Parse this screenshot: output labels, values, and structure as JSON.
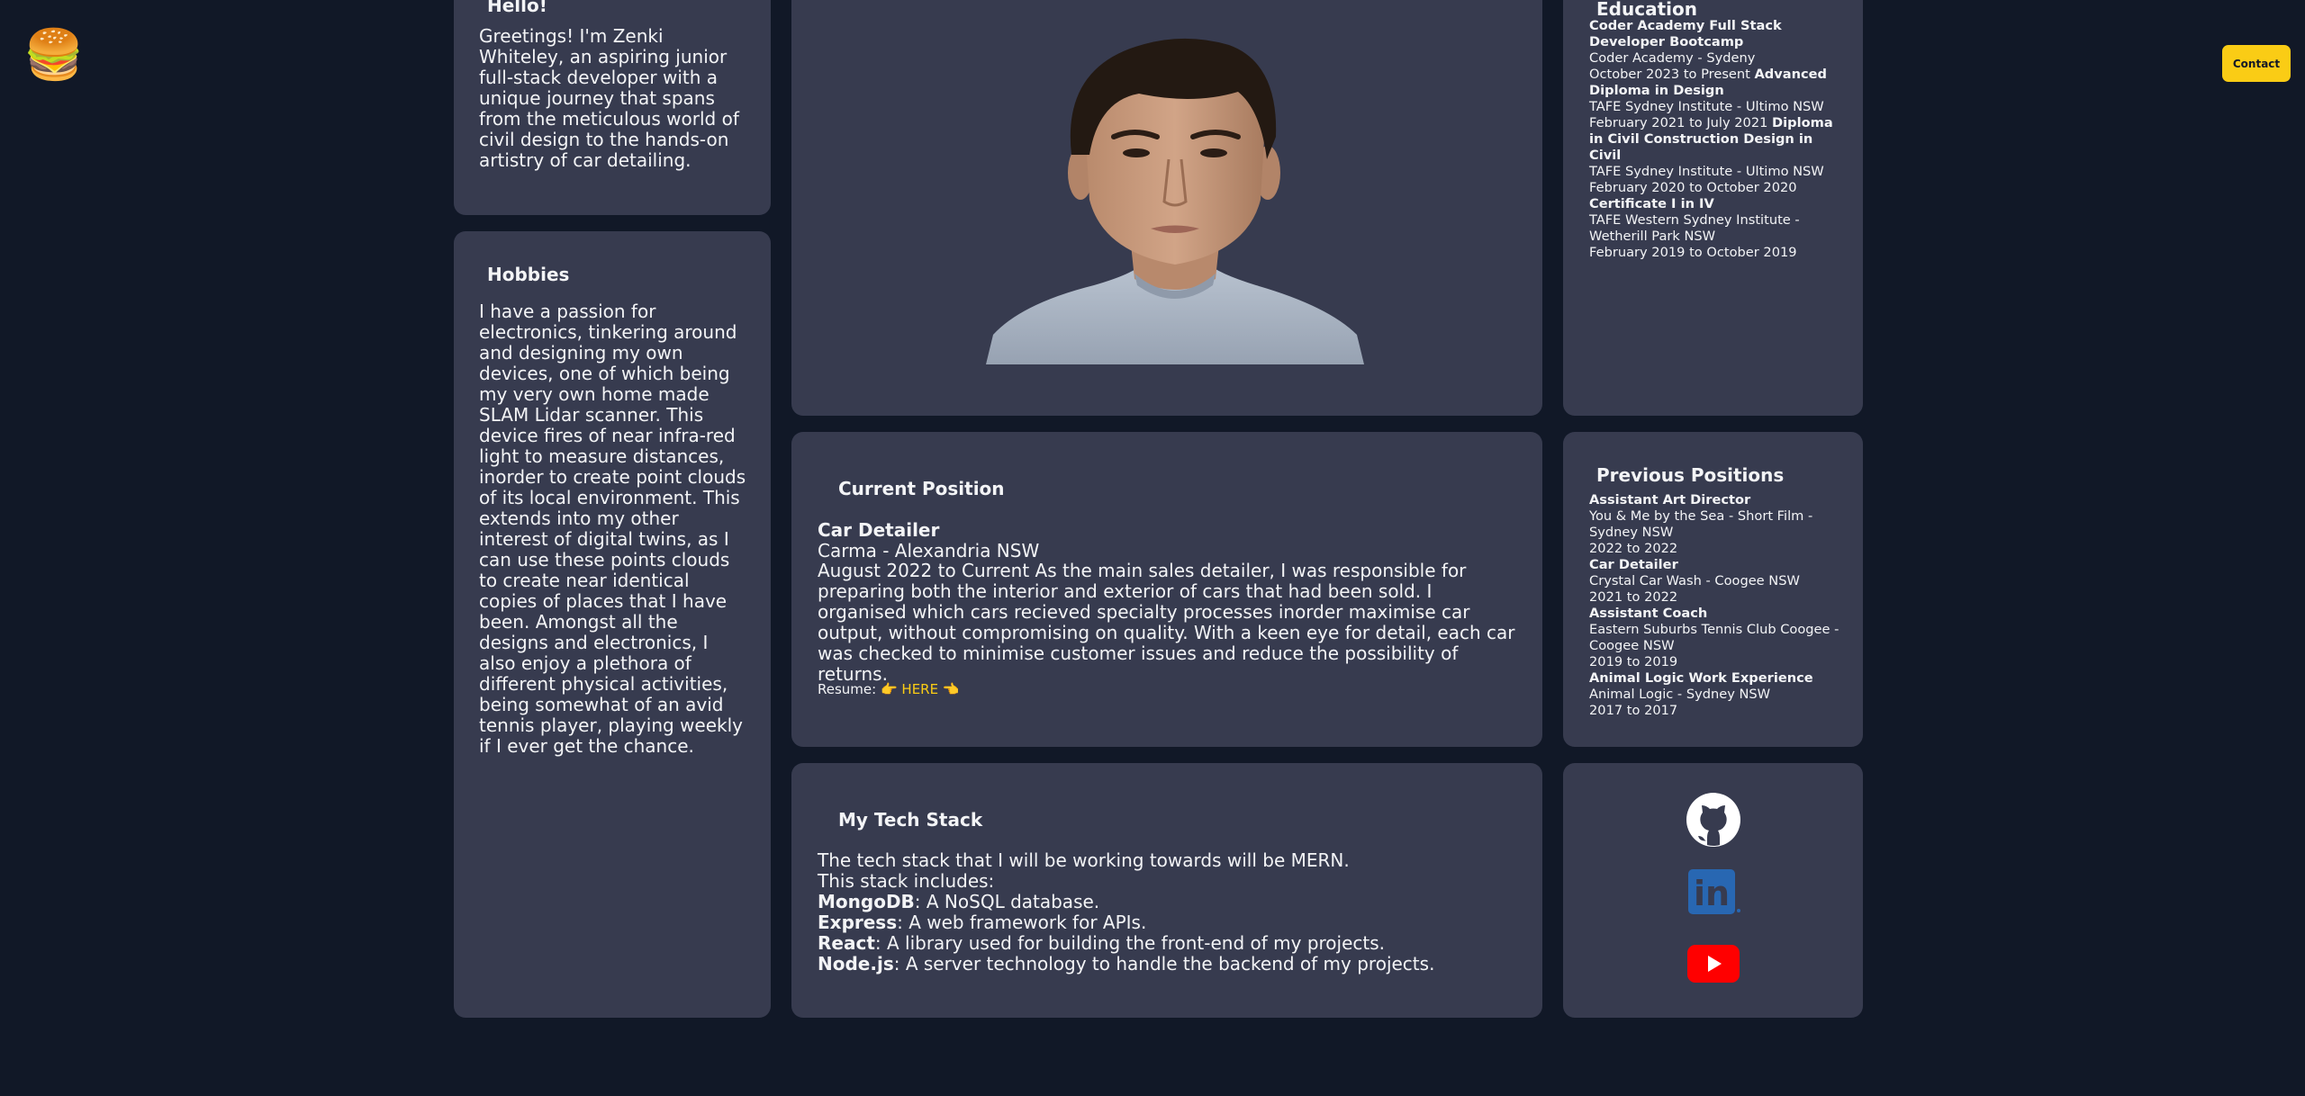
{
  "nav": {
    "menu_icon": "hamburger-emoji-icon",
    "menu_glyph": "🍔",
    "contact_label": "Contact"
  },
  "hello": {
    "title": "Hello!",
    "text": "Greetings! I'm Zenki Whiteley, an aspiring junior full-stack developer with a unique journey that spans from the meticulous world of civil design to the hands-on artistry of car detailing."
  },
  "hobbies": {
    "title": "Hobbies",
    "text": "I have a passion for electronics, tinkering around and designing my own devices, one of which being my very own home made SLAM Lidar scanner. This device fires of near infra-red light to measure distances, inorder to create point clouds of its local environment. This extends into my other interest of digital twins, as I can use these points clouds to create near identical copies of places that I have been. Amongst all the designs and electronics, I also enjoy a plethora of different physical activities, being somewhat of an avid tennis player, playing weekly if I ever get the chance."
  },
  "education": {
    "title": "Education",
    "items": [
      {
        "course": "Coder Academy Full Stack Developer Bootcamp",
        "institution": "Coder Academy - Sydeny",
        "dates": "October 2023 to Present"
      },
      {
        "course": "Advanced Diploma in Design",
        "institution": "TAFE Sydney Institute - Ultimo NSW",
        "dates": "February 2021 to July 2021"
      },
      {
        "course": "Diploma in Civil Construction Design in Civil",
        "institution": "TAFE Sydney Institute - Ultimo NSW",
        "dates": "February 2020 to October 2020"
      },
      {
        "course": "Certificate I in IV",
        "institution": "TAFE Western Sydney Institute - Wetherill Park NSW",
        "dates": "February 2019 to October 2019"
      }
    ]
  },
  "current": {
    "title": "Current Position",
    "role": "Car Detailer",
    "company": "Carma - Alexandria NSW",
    "dates": "August 2022 to Current",
    "description": "As the main sales detailer, I was responsible for preparing both the interior and exterior of cars that had been sold. I organised which cars recieved specialty processes inorder maximise car output, without compromising on quality. With a keen eye for detail, each car was checked to minimise customer issues and reduce the possibility of returns.",
    "resume_label": "Resume:",
    "resume_link": "👉 HERE 👈"
  },
  "previous": {
    "title": "Previous Positions",
    "items": [
      {
        "role": "Assistant Art Director",
        "company": "You & Me by the Sea - Short Film - Sydney NSW",
        "dates": "2022 to 2022"
      },
      {
        "role": "Car Detailer",
        "company": "Crystal Car Wash - Coogee NSW",
        "dates": "2021 to 2022"
      },
      {
        "role": "Assistant Coach",
        "company": "Eastern Suburbs Tennis Club Coogee - Coogee NSW",
        "dates": "2019 to 2019"
      },
      {
        "role": "Animal Logic Work Experience",
        "company": "Animal Logic - Sydney NSW",
        "dates": "2017 to 2017"
      }
    ]
  },
  "tech": {
    "title": "My Tech Stack",
    "intro1": "The tech stack that I will be working towards will be MERN.",
    "intro2": "This stack includes:",
    "items": [
      {
        "name": "MongoDB",
        "desc": ": A NoSQL database."
      },
      {
        "name": "Express",
        "desc": ": A web framework for APIs."
      },
      {
        "name": "React",
        "desc": ": A library used for building the front-end of my projects."
      },
      {
        "name": "Node.js",
        "desc": ": A server technology to handle the backend of my projects."
      }
    ]
  },
  "social": {
    "icons": [
      "github-icon",
      "linkedin-icon",
      "youtube-icon"
    ],
    "linkedin_text": "in"
  },
  "colors": {
    "background": "#111827",
    "card": "#373b4f",
    "accent": "#facc15",
    "linkedin": "#2867b2",
    "youtube": "#ff0000"
  }
}
